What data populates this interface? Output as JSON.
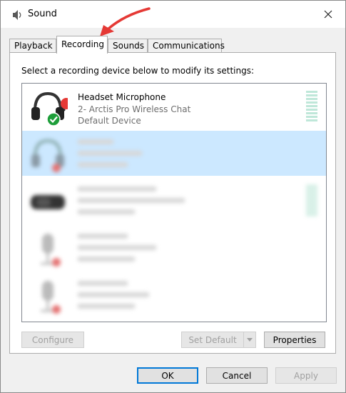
{
  "window": {
    "title": "Sound"
  },
  "tabs": [
    {
      "label": "Playback",
      "active": false
    },
    {
      "label": "Recording",
      "active": true
    },
    {
      "label": "Sounds",
      "active": false
    },
    {
      "label": "Communications",
      "active": false
    }
  ],
  "panel": {
    "instruction": "Select a recording device below to modify its settings:"
  },
  "devices": [
    {
      "name": "Headset Microphone",
      "description": "2- Arctis Pro Wireless Chat",
      "status": "Default Device",
      "is_default": true
    }
  ],
  "buttons": {
    "configure": "Configure",
    "set_default": "Set Default",
    "properties": "Properties",
    "ok": "OK",
    "cancel": "Cancel",
    "apply": "Apply"
  },
  "colors": {
    "selection": "#cce8ff",
    "annotation_arrow": "#e53935",
    "default_check": "#1e9e3a",
    "level_meter": "#bfe7d9",
    "primary_focus": "#0078d7"
  }
}
